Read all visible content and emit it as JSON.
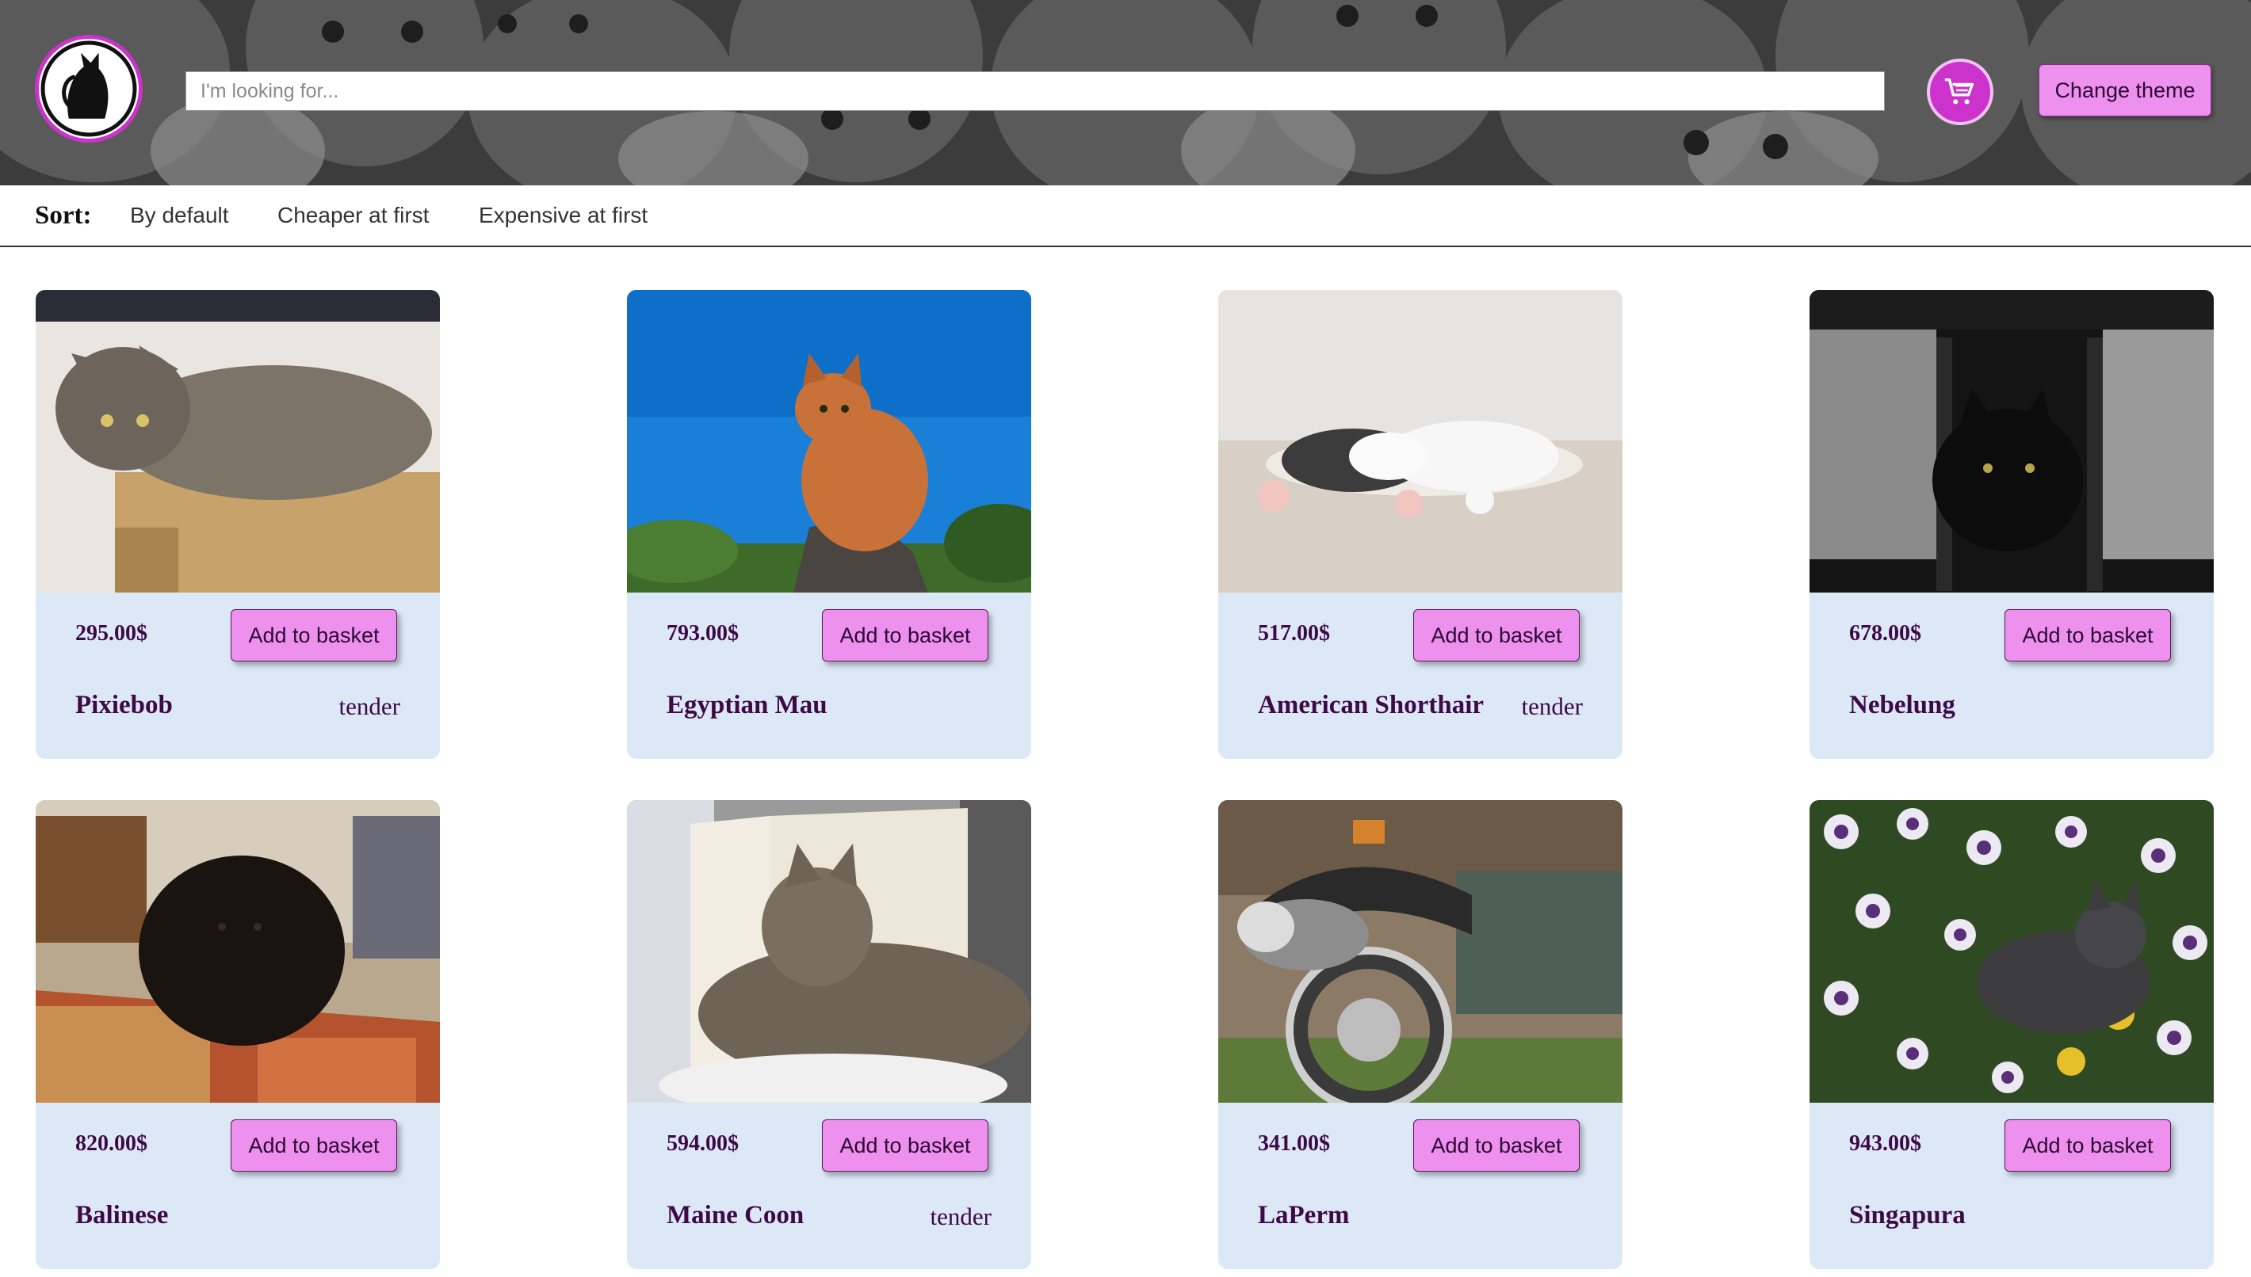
{
  "header": {
    "search_placeholder": "I'm looking for...",
    "change_theme_label": "Change theme",
    "logo_icon": "cat-logo-icon",
    "cart_icon": "shopping-cart-icon",
    "accent_color": "#cc33cc",
    "button_color": "#ee90ee"
  },
  "sort": {
    "label": "Sort:",
    "options": [
      "By default",
      "Cheaper at first",
      "Expensive at first"
    ]
  },
  "products": [
    {
      "price": "295.00$",
      "name": "Pixiebob",
      "trait": "tender",
      "button": "Add to basket"
    },
    {
      "price": "793.00$",
      "name": "Egyptian Mau",
      "trait": "",
      "button": "Add to basket"
    },
    {
      "price": "517.00$",
      "name": "American Shorthair",
      "trait": "tender",
      "button": "Add to basket"
    },
    {
      "price": "678.00$",
      "name": "Nebelung",
      "trait": "",
      "button": "Add to basket"
    },
    {
      "price": "820.00$",
      "name": "Balinese",
      "trait": "",
      "button": "Add to basket"
    },
    {
      "price": "594.00$",
      "name": "Maine Coon",
      "trait": "tender",
      "button": "Add to basket"
    },
    {
      "price": "341.00$",
      "name": "LaPerm",
      "trait": "",
      "button": "Add to basket"
    },
    {
      "price": "943.00$",
      "name": "Singapura",
      "trait": "",
      "button": "Add to basket"
    }
  ],
  "card_color": "#dde8f7",
  "text_color": "#3d0a45"
}
